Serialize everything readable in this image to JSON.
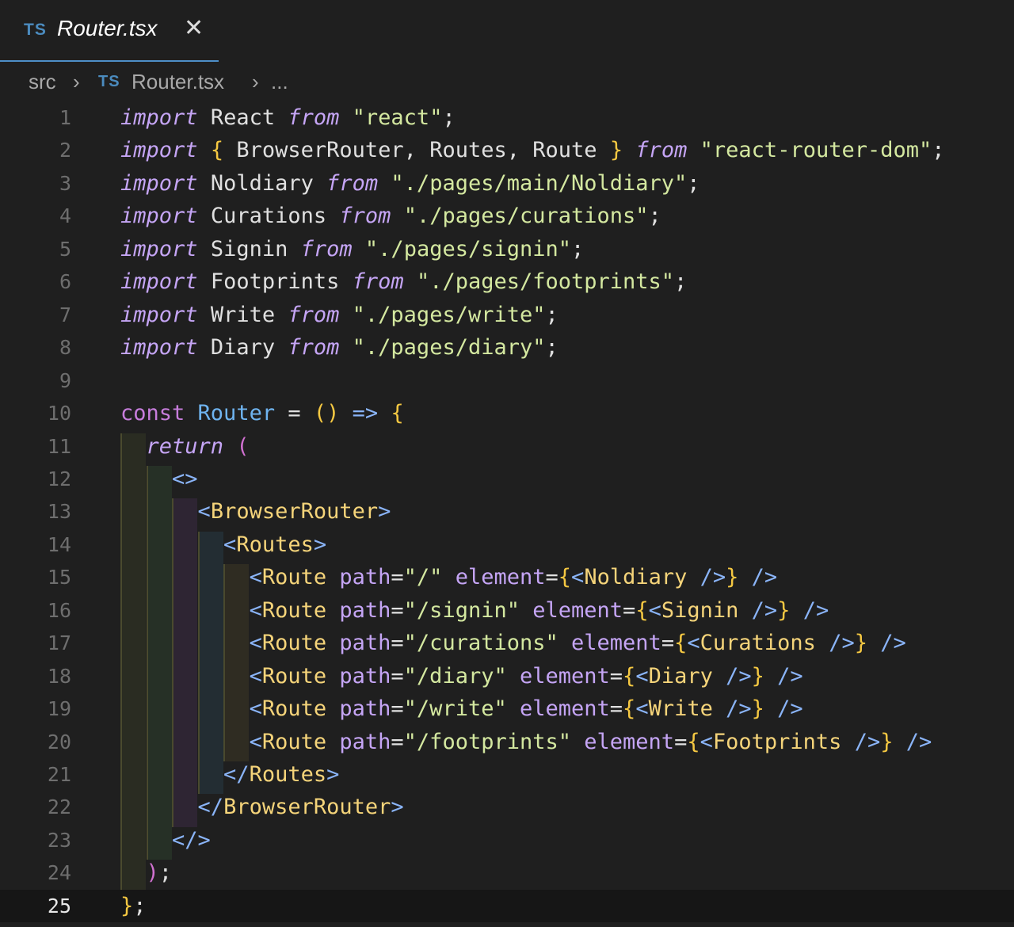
{
  "tab": {
    "lang_badge": "TS",
    "filename": "Router.tsx",
    "close_glyph": "✕"
  },
  "breadcrumb": {
    "folder": "src",
    "sep": "›",
    "lang_badge": "TS",
    "file": "Router.tsx",
    "more": "..."
  },
  "editor": {
    "current_line": 25,
    "line_numbers": [
      "1",
      "2",
      "3",
      "4",
      "5",
      "6",
      "7",
      "8",
      "9",
      "10",
      "11",
      "12",
      "13",
      "14",
      "15",
      "16",
      "17",
      "18",
      "19",
      "20",
      "21",
      "22",
      "23",
      "24",
      "25"
    ],
    "lines": [
      "import React from \"react\";",
      "import { BrowserRouter, Routes, Route } from \"react-router-dom\";",
      "import Noldiary from \"./pages/main/Noldiary\";",
      "import Curations from \"./pages/curations\";",
      "import Signin from \"./pages/signin\";",
      "import Footprints from \"./pages/footprints\";",
      "import Write from \"./pages/write\";",
      "import Diary from \"./pages/diary\";",
      "",
      "const Router = () => {",
      "  return (",
      "    <>",
      "      <BrowserRouter>",
      "        <Routes>",
      "          <Route path=\"/\" element={<Noldiary />} />",
      "          <Route path=\"/signin\" element={<Signin />} />",
      "          <Route path=\"/curations\" element={<Curations />} />",
      "          <Route path=\"/diary\" element={<Diary />} />",
      "          <Route path=\"/write\" element={<Write />} />",
      "          <Route path=\"/footprints\" element={<Footprints />} />",
      "        </Routes>",
      "      </BrowserRouter>",
      "    </>",
      "  );",
      "};"
    ]
  },
  "colors": {
    "background": "#1f1f1f",
    "tab_underline": "#4e8fc8",
    "ts_badge": "#4b8bbe",
    "keyword": "#c5a5f5",
    "string": "#d4e8a0",
    "tag": "#f5d47a",
    "function": "#6fb4f0"
  }
}
